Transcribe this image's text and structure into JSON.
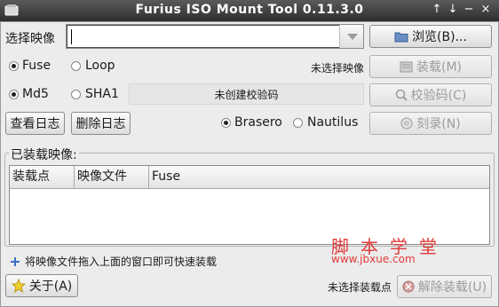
{
  "window": {
    "title": "Furius ISO Mount Tool 0.11.3.0",
    "controls": [
      "↑",
      "↓",
      "−",
      "×"
    ]
  },
  "image_select": {
    "label": "选择映像",
    "value": "",
    "browse_label": "浏览(B)...",
    "browse_mnemonic": "B"
  },
  "mount_type": {
    "fuse_label": "Fuse",
    "loop_label": "Loop",
    "selected": "Fuse"
  },
  "mount_status": "未选择映像",
  "mount_button": {
    "label": "装载(M)"
  },
  "checksum": {
    "md5_label": "Md5",
    "sha1_label": "SHA1",
    "selected": "Md5",
    "status": "未创建校验码",
    "button_label": "校验码(C)"
  },
  "log": {
    "view_label": "查看日志",
    "delete_label": "删除日志"
  },
  "burner": {
    "brasero_label": "Brasero",
    "nautilus_label": "Nautilus",
    "selected": "Brasero",
    "burn_label": "刻录(N)"
  },
  "mounted_images": {
    "frame_title": "已装载映像:",
    "columns": [
      "装载点",
      "映像文件",
      "Fuse"
    ],
    "rows": []
  },
  "watermark": {
    "line1": "脚本学堂",
    "line2": "www.jbxue.com"
  },
  "hint": "将映像文件拖入上面的窗口即可快速装载",
  "about_label": "关于(A)",
  "unmount_status": "未选择装载点",
  "unmount_label": "解除装载(U)"
}
